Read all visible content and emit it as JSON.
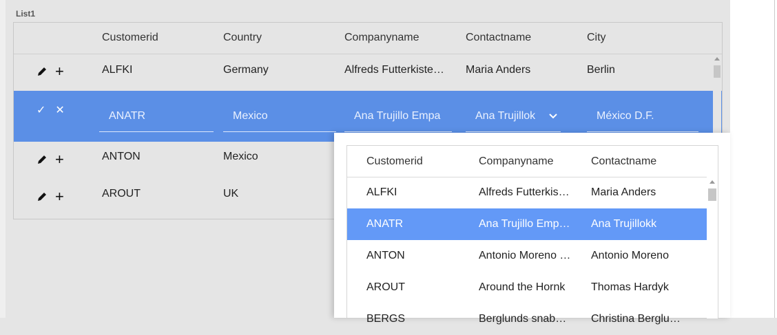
{
  "panel": {
    "title": "List1"
  },
  "grid": {
    "columns": [
      "Customerid",
      "Country",
      "Companyname",
      "Contactname",
      "City"
    ],
    "rows": [
      {
        "customerid": "ALFKI",
        "country": "Germany",
        "companyname": "Alfreds Futterkiste…",
        "contactname": "Maria Anders",
        "city": "Berlin"
      },
      {
        "customerid": "ANTON",
        "country": "Mexico",
        "companyname": "",
        "contactname": "",
        "city": ""
      },
      {
        "customerid": "AROUT",
        "country": "UK",
        "companyname": "",
        "contactname": "",
        "city": ""
      }
    ],
    "edit_row": {
      "customerid": "ANATR",
      "country": "Mexico",
      "companyname": "Ana Trujillo Empa",
      "contactname": "Ana Trujillok",
      "city": "México D.F."
    }
  },
  "dropdown": {
    "columns": [
      "Customerid",
      "Companyname",
      "Contactname"
    ],
    "rows": [
      {
        "customerid": "ALFKI",
        "companyname": "Alfreds Futterkis…",
        "contactname": "Maria Anders",
        "selected": false
      },
      {
        "customerid": "ANATR",
        "companyname": "Ana Trujillo Emp…",
        "contactname": "Ana Trujillokk",
        "selected": true
      },
      {
        "customerid": "ANTON",
        "companyname": "Antonio Moreno …",
        "contactname": "Antonio Moreno",
        "selected": false
      },
      {
        "customerid": "AROUT",
        "companyname": "Around the Hornk",
        "contactname": "Thomas Hardyk",
        "selected": false
      },
      {
        "customerid": "BERGS",
        "companyname": "Berglunds snab…",
        "contactname": "Christina Berglu…",
        "selected": false
      }
    ]
  },
  "icons": {
    "edit": "pencil-icon",
    "add": "plus-icon",
    "confirm": "check-icon",
    "cancel": "close-icon",
    "dropdown": "chevron-down-icon"
  },
  "colors": {
    "edit_row": "#5b8fe6",
    "selected_row": "#6399f7",
    "background": "#e5e5e5"
  }
}
